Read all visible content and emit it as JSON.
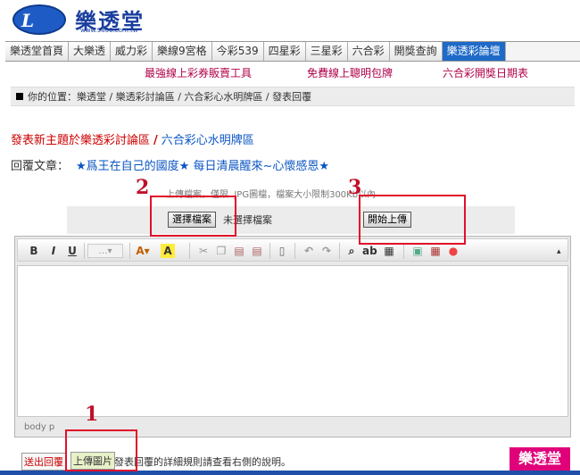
{
  "logo": {
    "brand": "樂透堂",
    "url": "www.9800.com.tw",
    "mark": "L"
  },
  "nav": [
    "樂透堂首頁",
    "大樂透",
    "威力彩",
    "樂線9宮格",
    "今彩539",
    "四星彩",
    "三星彩",
    "六合彩",
    "開獎查詢",
    "樂透彩論壇"
  ],
  "promo": [
    "最強線上彩券販賣工具",
    "免費線上聰明包牌",
    "六合彩開獎日期表"
  ],
  "breadcrumb": "你的位置：樂透堂 / 樂透彩討論區 / 六合彩心水明牌區 / 發表回覆",
  "topic": {
    "part1": "發表新主題於樂透彩討論區",
    "sep": "/",
    "part2": "六合彩心水明牌區"
  },
  "reply": {
    "label": "回覆文章：",
    "title": "★爲王在自己的國度★ 每日清晨醒來~心懷感恩★"
  },
  "upload": {
    "note": "上傳檔案，僅限 .JPG圖檔，檔案大小限制300Kb以內",
    "choose_button": "選擇檔案",
    "no_file": "未選擇檔案",
    "start_button": "開始上傳"
  },
  "editor": {
    "status": "body  p"
  },
  "bottom": {
    "submit": "送出回覆",
    "upload_image": "上傳圖片",
    "help_text": "發表回覆的詳細規則請查看右側的說明。"
  },
  "badge": "樂透堂",
  "annotations": [
    "1",
    "2",
    "3"
  ],
  "colors": {
    "annotation": "#e0102a",
    "nav_active": "#1f6ac8",
    "badge": "#e0007a"
  }
}
